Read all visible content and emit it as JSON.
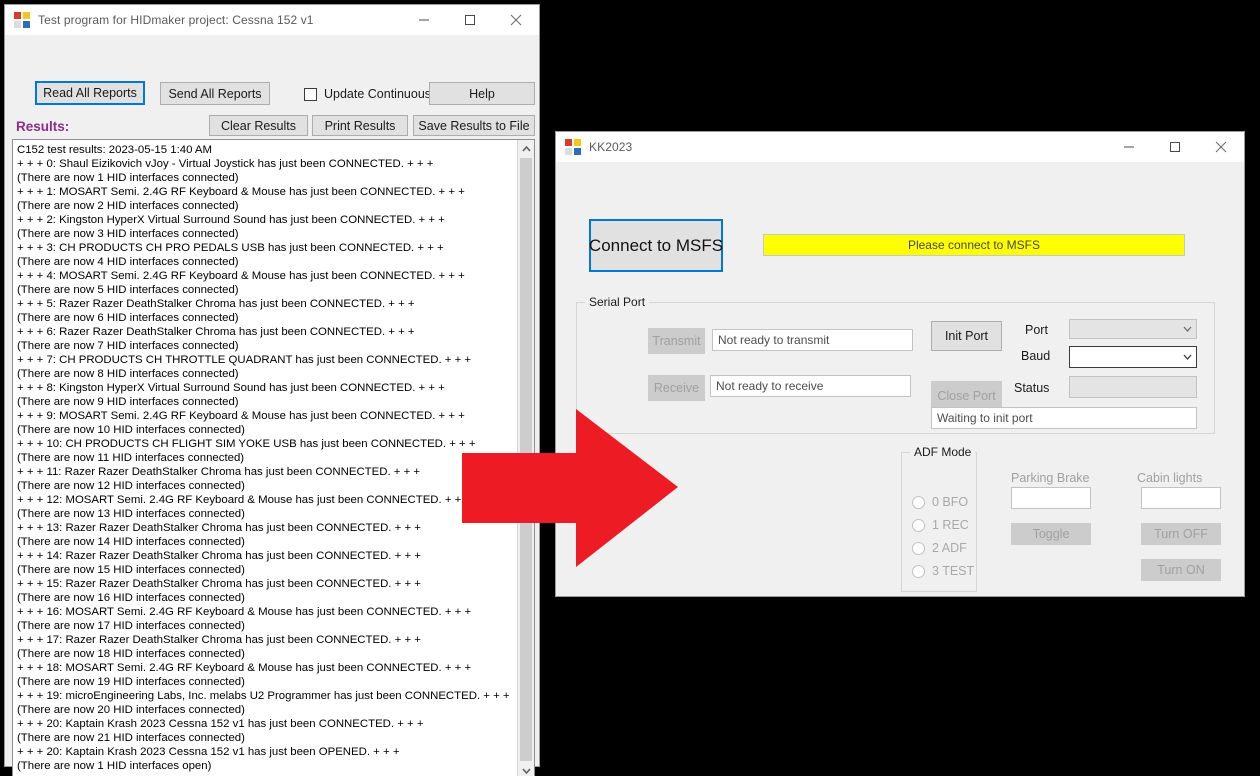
{
  "colors": {
    "desktop": "#000000",
    "window_bg": "#f0f0f0",
    "accent_focus": "#0078d7",
    "results_label": "#8b2f8b",
    "status_yellow": "#ffff00",
    "arrow_red": "#ed1c24"
  },
  "hidmaker_window": {
    "title": "Test program for HIDmaker project: Cessna 152 v1",
    "icon": "app-icon",
    "titlebar_buttons": {
      "minimize": "minimize-icon",
      "maximize": "maximize-icon",
      "close": "close-icon"
    },
    "toolbar": {
      "read_all_reports": "Read All Reports",
      "send_all_reports": "Send All Reports",
      "update_continuously": "Update Continuously",
      "update_continuously_checked": false,
      "help": "Help"
    },
    "results_label": "Results:",
    "results_toolbar": {
      "clear_results": "Clear Results",
      "print_results": "Print Results",
      "save_results_to_file": "Save Results to File"
    },
    "results_lines": [
      "C152 test results:  2023-05-15 1:40 AM",
      "+ + + 0: Shaul Eizikovich vJoy - Virtual Joystick has just been CONNECTED. + + +",
      "(There are now 1 HID interfaces connected)",
      "+ + + 1: MOSART Semi. 2.4G RF Keyboard & Mouse has just been CONNECTED. + + +",
      "(There are now 2 HID interfaces connected)",
      "+ + + 2: Kingston HyperX Virtual Surround Sound has just been CONNECTED. + + +",
      "(There are now 3 HID interfaces connected)",
      "+ + + 3: CH PRODUCTS CH PRO PEDALS USB  has just been CONNECTED. + + +",
      "(There are now 4 HID interfaces connected)",
      "+ + + 4: MOSART Semi. 2.4G RF Keyboard & Mouse has just been CONNECTED. + + +",
      "(There are now 5 HID interfaces connected)",
      "+ + + 5: Razer Razer DeathStalker Chroma has just been CONNECTED. + + +",
      "(There are now 6 HID interfaces connected)",
      "+ + + 6: Razer Razer DeathStalker Chroma has just been CONNECTED. + + +",
      "(There are now 7 HID interfaces connected)",
      "+ + + 7: CH PRODUCTS CH THROTTLE QUADRANT has just been CONNECTED. + + +",
      "(There are now 8 HID interfaces connected)",
      "+ + + 8: Kingston HyperX Virtual Surround Sound has just been CONNECTED. + + +",
      "(There are now 9 HID interfaces connected)",
      "+ + + 9: MOSART Semi. 2.4G RF Keyboard & Mouse has just been CONNECTED. + + +",
      "(There are now 10 HID interfaces connected)",
      "+ + + 10: CH PRODUCTS CH FLIGHT SIM YOKE USB  has just been CONNECTED. + + +",
      "(There are now 11 HID interfaces connected)",
      "+ + + 11: Razer Razer DeathStalker Chroma has just been CONNECTED. + + +",
      "(There are now 12 HID interfaces connected)",
      "+ + + 12: MOSART Semi. 2.4G RF Keyboard & Mouse has just been CONNECTED. + + +",
      "(There are now 13 HID interfaces connected)",
      "+ + + 13: Razer Razer DeathStalker Chroma has just been CONNECTED. + + +",
      "(There are now 14 HID interfaces connected)",
      "+ + + 14: Razer Razer DeathStalker Chroma has just been CONNECTED. + + +",
      "(There are now 15 HID interfaces connected)",
      "+ + + 15: Razer Razer DeathStalker Chroma has just been CONNECTED. + + +",
      "(There are now 16 HID interfaces connected)",
      "+ + + 16: MOSART Semi. 2.4G RF Keyboard & Mouse has just been CONNECTED. + + +",
      "(There are now 17 HID interfaces connected)",
      "+ + + 17: Razer Razer DeathStalker Chroma has just been CONNECTED. + + +",
      "(There are now 18 HID interfaces connected)",
      "+ + + 18: MOSART Semi. 2.4G RF Keyboard & Mouse has just been CONNECTED. + + +",
      "(There are now 19 HID interfaces connected)",
      "+ + + 19: microEngineering Labs, Inc. melabs U2 Programmer has just been CONNECTED. + + +",
      "(There are now 20 HID interfaces connected)",
      "+ + + 20: Kaptain Krash 2023 Cessna 152 v1 has just been CONNECTED. + + +",
      "(There are now 21 HID interfaces connected)",
      "+ + + 20: Kaptain Krash 2023 Cessna 152 v1 has just been OPENED. + + +",
      "(There are now 1 HID interfaces open)"
    ],
    "scrollbar": {
      "up_arrow": "chevron-up-icon",
      "down_arrow": "chevron-down-icon"
    }
  },
  "kk2023_window": {
    "title": "KK2023",
    "icon": "app-icon",
    "titlebar_buttons": {
      "minimize": "minimize-icon",
      "maximize": "maximize-icon",
      "close": "close-icon"
    },
    "connect_button": "Connect to MSFS",
    "connection_status": "Please connect to MSFS",
    "serial_port": {
      "group_title": "Serial Port",
      "transmit_button": "Transmit",
      "transmit_status": "Not ready to transmit",
      "receive_button": "Receive",
      "receive_status": "Not ready to receive",
      "init_port_button": "Init Port",
      "close_port_button": "Close Port",
      "port_label": "Port",
      "port_value": "",
      "baud_label": "Baud",
      "baud_value": "",
      "status_label": "Status",
      "status_value": "",
      "port_state": "Waiting to init port"
    },
    "adf_mode": {
      "group_title": "ADF Mode",
      "options": [
        {
          "label": "0 BFO",
          "checked": false
        },
        {
          "label": "1 REC",
          "checked": false
        },
        {
          "label": "2 ADF",
          "checked": false
        },
        {
          "label": "3 TEST",
          "checked": false
        }
      ]
    },
    "parking_brake": {
      "label": "Parking Brake",
      "value": "",
      "toggle_button": "Toggle"
    },
    "cabin_lights": {
      "label": "Cabin lights",
      "value": "",
      "turn_off_button": "Turn OFF",
      "turn_on_button": "Turn ON"
    }
  },
  "annotation": {
    "arrow": "red-right-arrow"
  }
}
